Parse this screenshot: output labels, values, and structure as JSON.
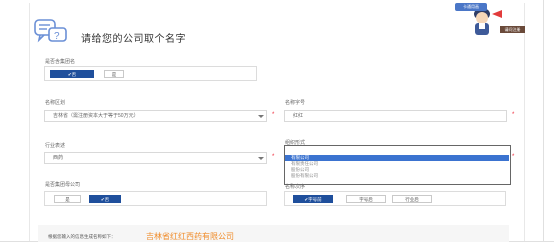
{
  "header": {
    "title": "请给您的公司取个名字",
    "badge": "卡通用画",
    "caption": "请问注册"
  },
  "group_name": {
    "label": "是否含集团名",
    "options": [
      "✔否",
      "是"
    ],
    "selected": 0
  },
  "region": {
    "label": "名称区划",
    "value": "吉林省（需注册资本大于等于50万元）"
  },
  "trade_name": {
    "label": "名称字号",
    "value": "红红"
  },
  "industry": {
    "label": "行业表述",
    "value": "西药"
  },
  "org_form": {
    "label": "组织形式",
    "options": [
      "有限公司",
      "有限责任公司",
      "股份公司",
      "股份有限公司"
    ],
    "selected": 0
  },
  "parent_company": {
    "label": "是否集团母公司",
    "options": [
      "是",
      "✔否"
    ],
    "selected": 1
  },
  "order": {
    "label": "名称次序",
    "options": [
      "✔字号前",
      "字号后",
      "行业后"
    ],
    "selected": 0
  },
  "result": {
    "label": "根据您输入的信息生成名称如下：",
    "value": "吉林省红红西药有限公司"
  },
  "colors": {
    "accent": "#1f4f9c",
    "highlight": "#3b73d0",
    "result": "#f08c2a",
    "required": "#e22233"
  }
}
